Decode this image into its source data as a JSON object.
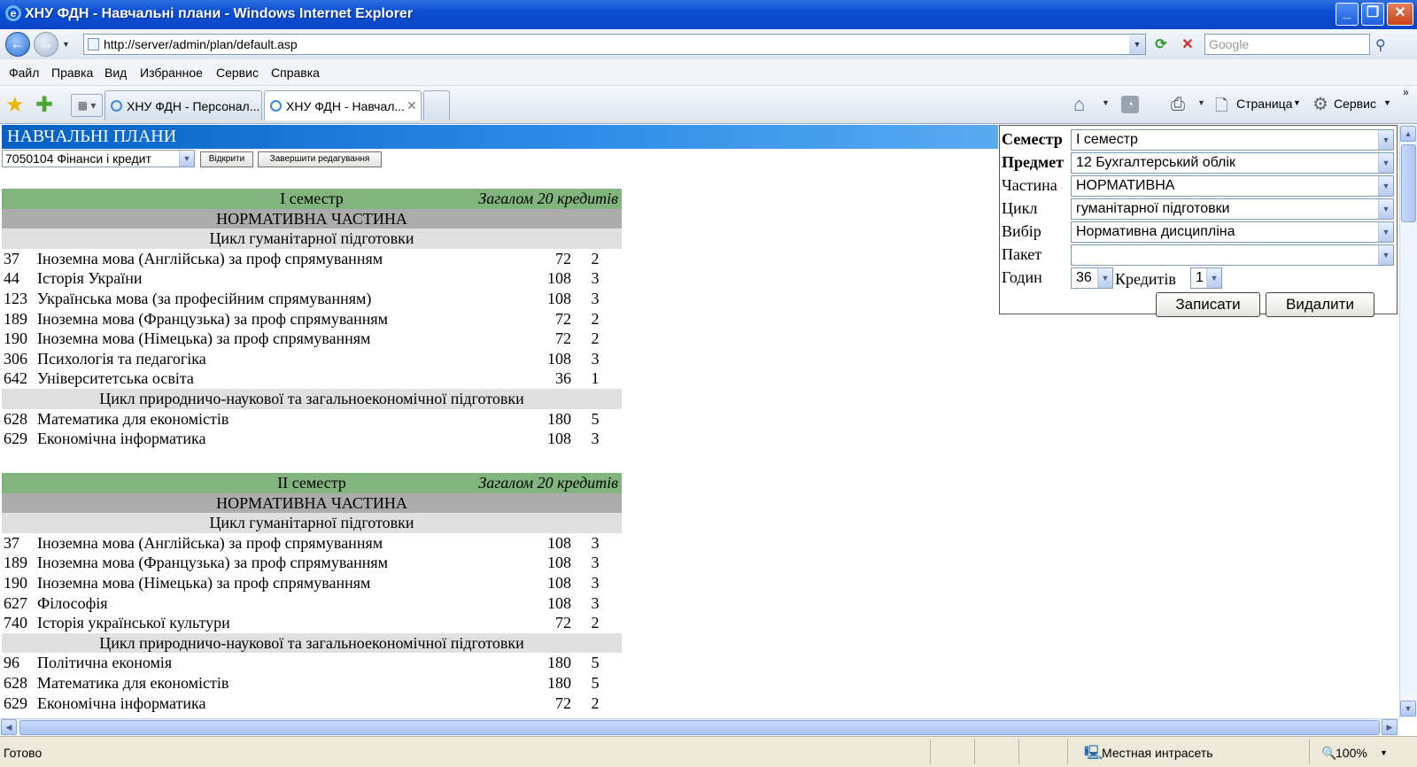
{
  "window": {
    "title": "ХНУ ФДН - Навчальні плани - Windows Internet Explorer"
  },
  "address": {
    "url": "http://server/admin/plan/default.asp",
    "search_placeholder": "Google"
  },
  "menu": [
    "Файл",
    "Правка",
    "Вид",
    "Избранное",
    "Сервис",
    "Справка"
  ],
  "tabs": [
    {
      "label": "ХНУ ФДН - Персонал..."
    },
    {
      "label": "ХНУ ФДН - Навчал..."
    }
  ],
  "toolbar": {
    "page_label": "Страница",
    "tools_label": "Сервис"
  },
  "page": {
    "title": "НАВЧАЛЬНІ ПЛАНИ",
    "specialty": "7050104 Фінанси і кредит",
    "open_button": "Відкрити",
    "finish_button": "Завершити редагування"
  },
  "semesters": [
    {
      "name": "I семестр",
      "total": "Загалом 20 кредитів",
      "part": "НОРМАТИВНА ЧАСТИНА",
      "cycles": [
        {
          "name": "Цикл гуманітарної підготовки",
          "rows": [
            {
              "code": "37",
              "name": "Іноземна мова (Англійська) за проф спрямуванням",
              "hours": "72",
              "credits": "2"
            },
            {
              "code": "44",
              "name": "Історія України",
              "hours": "108",
              "credits": "3"
            },
            {
              "code": "123",
              "name": "Українська мова (за професійним спрямуванням)",
              "hours": "108",
              "credits": "3"
            },
            {
              "code": "189",
              "name": "Іноземна мова (Французька) за проф спрямуванням",
              "hours": "72",
              "credits": "2"
            },
            {
              "code": "190",
              "name": "Іноземна мова (Німецька) за проф спрямуванням",
              "hours": "72",
              "credits": "2"
            },
            {
              "code": "306",
              "name": "Психологія та педагогіка",
              "hours": "108",
              "credits": "3"
            },
            {
              "code": "642",
              "name": "Університетська освіта",
              "hours": "36",
              "credits": "1"
            }
          ]
        },
        {
          "name": "Цикл природничо-наукової та загальноекономічної підготовки",
          "rows": [
            {
              "code": "628",
              "name": "Математика для економістів",
              "hours": "180",
              "credits": "5"
            },
            {
              "code": "629",
              "name": "Економічна інформатика",
              "hours": "108",
              "credits": "3"
            }
          ]
        }
      ]
    },
    {
      "name": "II семестр",
      "total": "Загалом 20 кредитів",
      "part": "НОРМАТИВНА ЧАСТИНА",
      "cycles": [
        {
          "name": "Цикл гуманітарної підготовки",
          "rows": [
            {
              "code": "37",
              "name": "Іноземна мова (Англійська) за проф спрямуванням",
              "hours": "108",
              "credits": "3"
            },
            {
              "code": "189",
              "name": "Іноземна мова (Французька) за проф спрямуванням",
              "hours": "108",
              "credits": "3"
            },
            {
              "code": "190",
              "name": "Іноземна мова (Німецька) за проф спрямуванням",
              "hours": "108",
              "credits": "3"
            },
            {
              "code": "627",
              "name": "Філософія",
              "hours": "108",
              "credits": "3"
            },
            {
              "code": "740",
              "name": "Історія української культури",
              "hours": "72",
              "credits": "2"
            }
          ]
        },
        {
          "name": "Цикл природничо-наукової та загальноекономічної підготовки",
          "rows": [
            {
              "code": "96",
              "name": "Політична економія",
              "hours": "180",
              "credits": "5"
            },
            {
              "code": "628",
              "name": "Математика для економістів",
              "hours": "180",
              "credits": "5"
            },
            {
              "code": "629",
              "name": "Економічна інформатика",
              "hours": "72",
              "credits": "2"
            }
          ]
        }
      ]
    }
  ],
  "form": {
    "semester_label": "Семестр",
    "semester_value": "I семестр",
    "subject_label": "Предмет",
    "subject_value": "12 Бухгалтерський облік",
    "part_label": "Частина",
    "part_value": "НОРМАТИВНА",
    "cycle_label": "Цикл",
    "cycle_value": "гуманітарної підготовки",
    "choice_label": "Вибір",
    "choice_value": "Нормативна дисципліна",
    "package_label": "Пакет",
    "package_value": "",
    "hours_label": "Годин",
    "hours_value": "36",
    "credits_label": "Кредитів",
    "credits_value": "1",
    "save_button": "Записати",
    "delete_button": "Видалити"
  },
  "status": {
    "text": "Готово",
    "zone": "Местная интрасеть",
    "zoom": "100%"
  }
}
